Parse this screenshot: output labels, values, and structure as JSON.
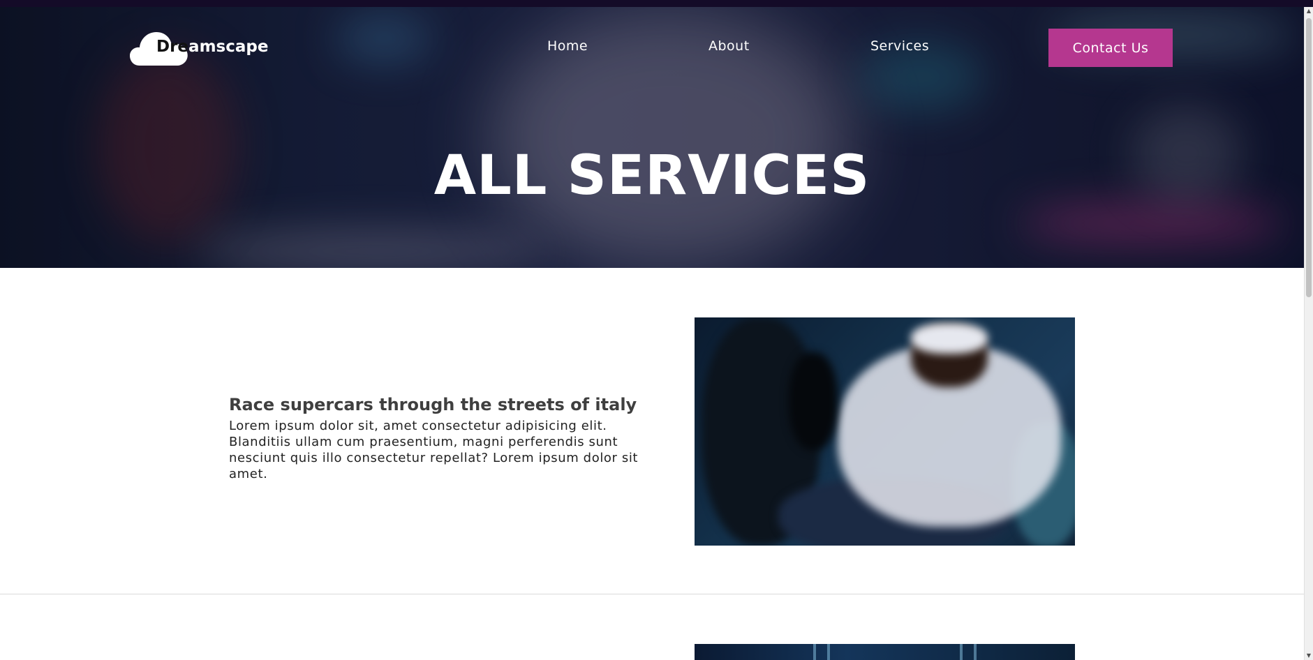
{
  "brand": {
    "name_dark_part": "Dre",
    "name_light_part": "amscape",
    "logo_icon": "cloud-icon"
  },
  "nav": {
    "links": [
      {
        "label": "Home"
      },
      {
        "label": "About"
      },
      {
        "label": "Services"
      }
    ],
    "cta_label": "Contact Us"
  },
  "hero": {
    "title": "ALL SERVICES"
  },
  "services": [
    {
      "title": "Race supercars through the streets of italy",
      "description": "Lorem ipsum dolor sit, amet consectetur adipisicing elit. Blanditiis ullam cum praesentium, magni perferendis sunt nesciunt quis illo consectetur repellat? Lorem ipsum dolor sit amet."
    }
  ],
  "colors": {
    "accent": "#b5378f",
    "top_strip": "#140b28",
    "heading_text": "#3f3f3f",
    "body_text": "#222222"
  },
  "scrollbar": {
    "up_icon": "chevron-up-icon",
    "down_icon": "chevron-down-icon"
  }
}
